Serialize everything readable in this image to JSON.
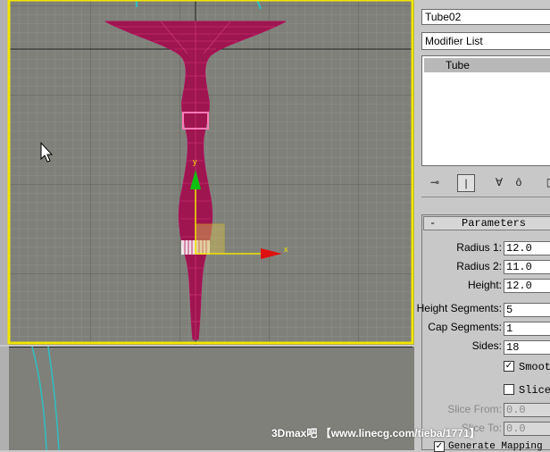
{
  "panel": {
    "object_name": "Tube02",
    "modifier_list": "Modifier List",
    "stack_items": [
      "Tube"
    ],
    "rollout": {
      "collapse_sign": "-",
      "title": "Parameters",
      "params": [
        {
          "label": "Radius 1:",
          "value": "12.0"
        },
        {
          "label": "Radius 2:",
          "value": "11.0"
        },
        {
          "label": "Height:",
          "value": "12.0"
        },
        {
          "label": "Height Segments:",
          "value": "5"
        },
        {
          "label": "Cap Segments:",
          "value": "1"
        },
        {
          "label": "Sides:",
          "value": "18"
        }
      ],
      "smooth_label": "Smoot",
      "smooth_checked": "✓",
      "slice_on_label": "Slice",
      "slice_from_label": "Slice From:",
      "slice_from_value": "0.0",
      "slice_to_label": "Slice To:",
      "slice_to_value": "0.0",
      "generate_mapping_label": "Generate Mapping",
      "generate_mapping_checked": "✓"
    },
    "toolbar": {
      "pin_icon": "pin-icon",
      "show_end_icon": "show-end-result-icon",
      "make_unique_icon": "make-unique-icon",
      "remove_modifier_icon": "remove-modifier-icon",
      "configure_icon": "configure-icon"
    }
  },
  "viewport": {
    "axis_x": "x",
    "axis_y": "y",
    "grid_color": "#8a8a8a",
    "bg_color": "#7f807a",
    "wire_color": "#a3104f",
    "active_border": "#f2e600"
  },
  "watermark": "3Dmax吧 【www.linecg.com/tieba/1771】"
}
